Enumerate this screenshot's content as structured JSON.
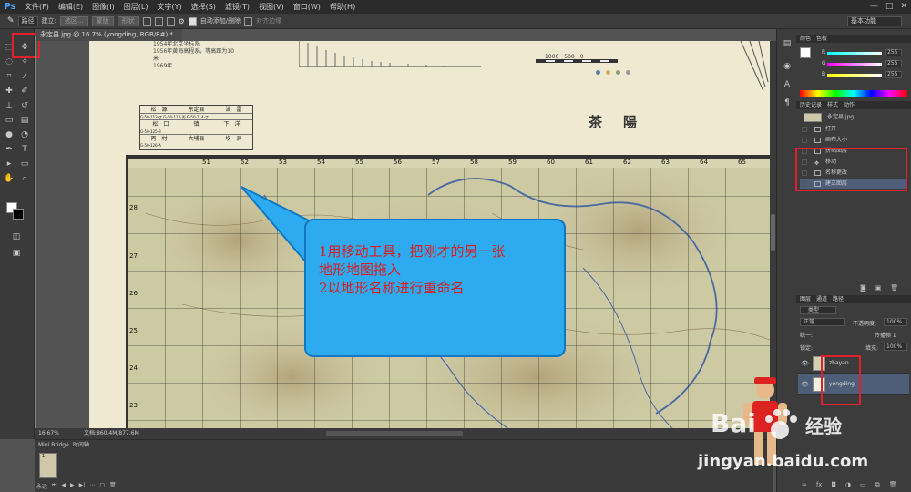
{
  "menubar": {
    "logo": "Ps",
    "items": [
      "文件(F)",
      "编辑(E)",
      "图像(I)",
      "图层(L)",
      "文字(Y)",
      "选择(S)",
      "滤镜(T)",
      "视图(V)",
      "窗口(W)",
      "帮助(H)"
    ],
    "window_controls": [
      "—",
      "□",
      "✕"
    ]
  },
  "options": {
    "tool_mode": "路径",
    "create_label": "建立:",
    "selection_btn": "选区...",
    "mask_btn": "蒙版",
    "shape_btn": "形状",
    "auto_add_delete": "自动添加/删除",
    "align_edges": "对齐边缘",
    "workspace": "基本功能"
  },
  "document": {
    "tab_title": "永定县.jpg @ 16.7% (yongding, RGB/8#) *",
    "zoom": "16.67%",
    "doc_size": "文档:860.4M/877.6M"
  },
  "map": {
    "title": "茶　陽",
    "legend_rows": [
      [
        "松　源",
        "东定县",
        "湖　雷"
      ],
      [
        "松　口",
        "镇",
        "下　洋"
      ],
      [
        "丙　村",
        "大埔县",
        "坎　洞"
      ]
    ],
    "legend_codes": [
      "G-50-113-丁 G-50-114-丙 G-50-114-丁",
      "G-50-125-B",
      "G-50-126-A"
    ],
    "col_labels": [
      "51",
      "52",
      "53",
      "54",
      "55",
      "56",
      "57",
      "58",
      "59",
      "60",
      "61",
      "62",
      "63",
      "64",
      "65"
    ],
    "row_labels": [
      "28",
      "27",
      "26",
      "25",
      "24",
      "23"
    ],
    "scale_text": "1000　500　0",
    "top_notes": [
      "1954年北京坐标系",
      "1956年黄海高程系，等高距为10米",
      "1969年"
    ]
  },
  "callout": {
    "line1": "1用移动工具，把刚才的另一张",
    "line2": "地形地图拖入",
    "line3": "2以地形名称进行重命名"
  },
  "color_panel": {
    "tabs": [
      "颜色",
      "色板"
    ],
    "channels": [
      {
        "label": "R",
        "value": "255"
      },
      {
        "label": "G",
        "value": "255"
      },
      {
        "label": "B",
        "value": "255"
      }
    ]
  },
  "history_panel": {
    "tabs": [
      "历史记录",
      "样式",
      "动作"
    ],
    "snapshot": "永定县.jpg",
    "items": [
      "打开",
      "画布大小",
      "拼贴图层",
      "移动",
      "名称更改",
      "建立图层"
    ]
  },
  "layers_panel": {
    "tabs": [
      "图层",
      "通道",
      "路径"
    ],
    "filter": "类型",
    "blend_mode": "正常",
    "opacity_label": "不透明度:",
    "opacity": "100%",
    "lock_label": "锁定:",
    "fill_label": "填充:",
    "fill": "100%",
    "propagate": "传播帧 1",
    "unify": "统一:",
    "layers": [
      {
        "name": "zhayan"
      },
      {
        "name": "yongding"
      }
    ]
  },
  "bottom_panel": {
    "tabs": [
      "Mini Bridge",
      "时间轴"
    ],
    "frame_label": "1",
    "frame_time": "0秒",
    "loop": "永远"
  },
  "watermark": {
    "logo": "Bai",
    "logo_cn": "经验",
    "url": "jingyan.baidu.com"
  },
  "colors": {
    "highlight": "#e0202a",
    "callout_fill": "#2eaaf0",
    "callout_text": "#d81e1e"
  }
}
